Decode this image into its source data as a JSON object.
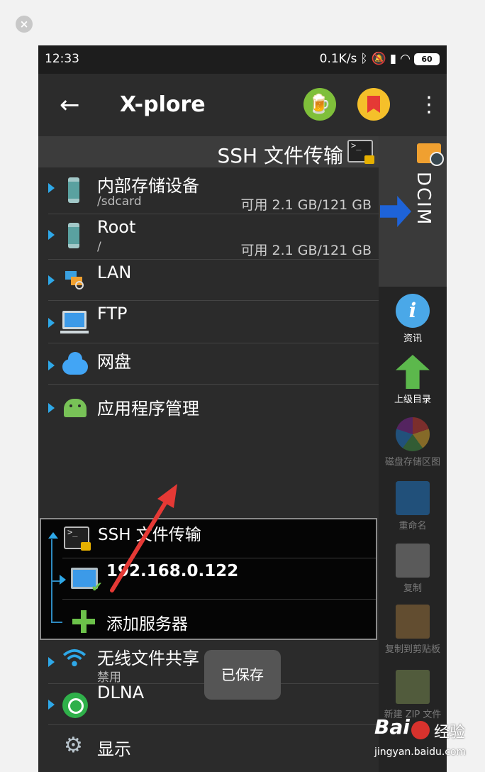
{
  "window": {
    "close_label": "×"
  },
  "status_bar": {
    "time": "12:33",
    "network_speed": "0.1K/s",
    "battery": "60",
    "icons": [
      "bluetooth-icon",
      "mute-icon",
      "signal-icon",
      "wifi-icon"
    ]
  },
  "app_bar": {
    "back_icon": "←",
    "title": "X-plore",
    "menu_icon": "⋮"
  },
  "left_panel": {
    "header": "SSH 文件传输",
    "items": [
      {
        "label": "内部存储设备",
        "sub": "/sdcard",
        "free": "可用 2.1 GB/121 GB"
      },
      {
        "label": "Root",
        "sub": "/",
        "free": "可用 2.1 GB/121 GB"
      },
      {
        "label": "LAN"
      },
      {
        "label": "FTP"
      },
      {
        "label": "网盘"
      },
      {
        "label": "应用程序管理"
      }
    ],
    "ssh_section": {
      "label": "SSH 文件传输",
      "server": "192.168.0.122",
      "add_server": "添加服务器"
    },
    "after_items": [
      {
        "label": "无线文件共享",
        "sub": "禁用"
      },
      {
        "label": "DLNA"
      },
      {
        "label": "显示"
      }
    ]
  },
  "toast": "已保存",
  "right_panel": {
    "folder_label": "DCIM",
    "tools": [
      {
        "label": "资讯",
        "icon": "info-icon",
        "enabled": true
      },
      {
        "label": "上级目录",
        "icon": "up-arrow-icon",
        "enabled": true
      },
      {
        "label": "磁盘存储区图",
        "icon": "pie-chart-icon",
        "enabled": false
      },
      {
        "label": "重命名",
        "icon": "edit-icon",
        "enabled": false
      },
      {
        "label": "复制",
        "icon": "copy-icon",
        "enabled": false
      },
      {
        "label": "复制到剪贴板",
        "icon": "clipboard-icon",
        "enabled": false
      },
      {
        "label": "新建 ZIP 文件",
        "icon": "zip-icon",
        "enabled": false
      }
    ]
  },
  "watermark": {
    "brand": "Bai",
    "suffix": "经验",
    "url": "jingyan.baidu.com"
  },
  "colors": {
    "accent": "#2ea8e8",
    "annotation_arrow": "#e53935"
  }
}
